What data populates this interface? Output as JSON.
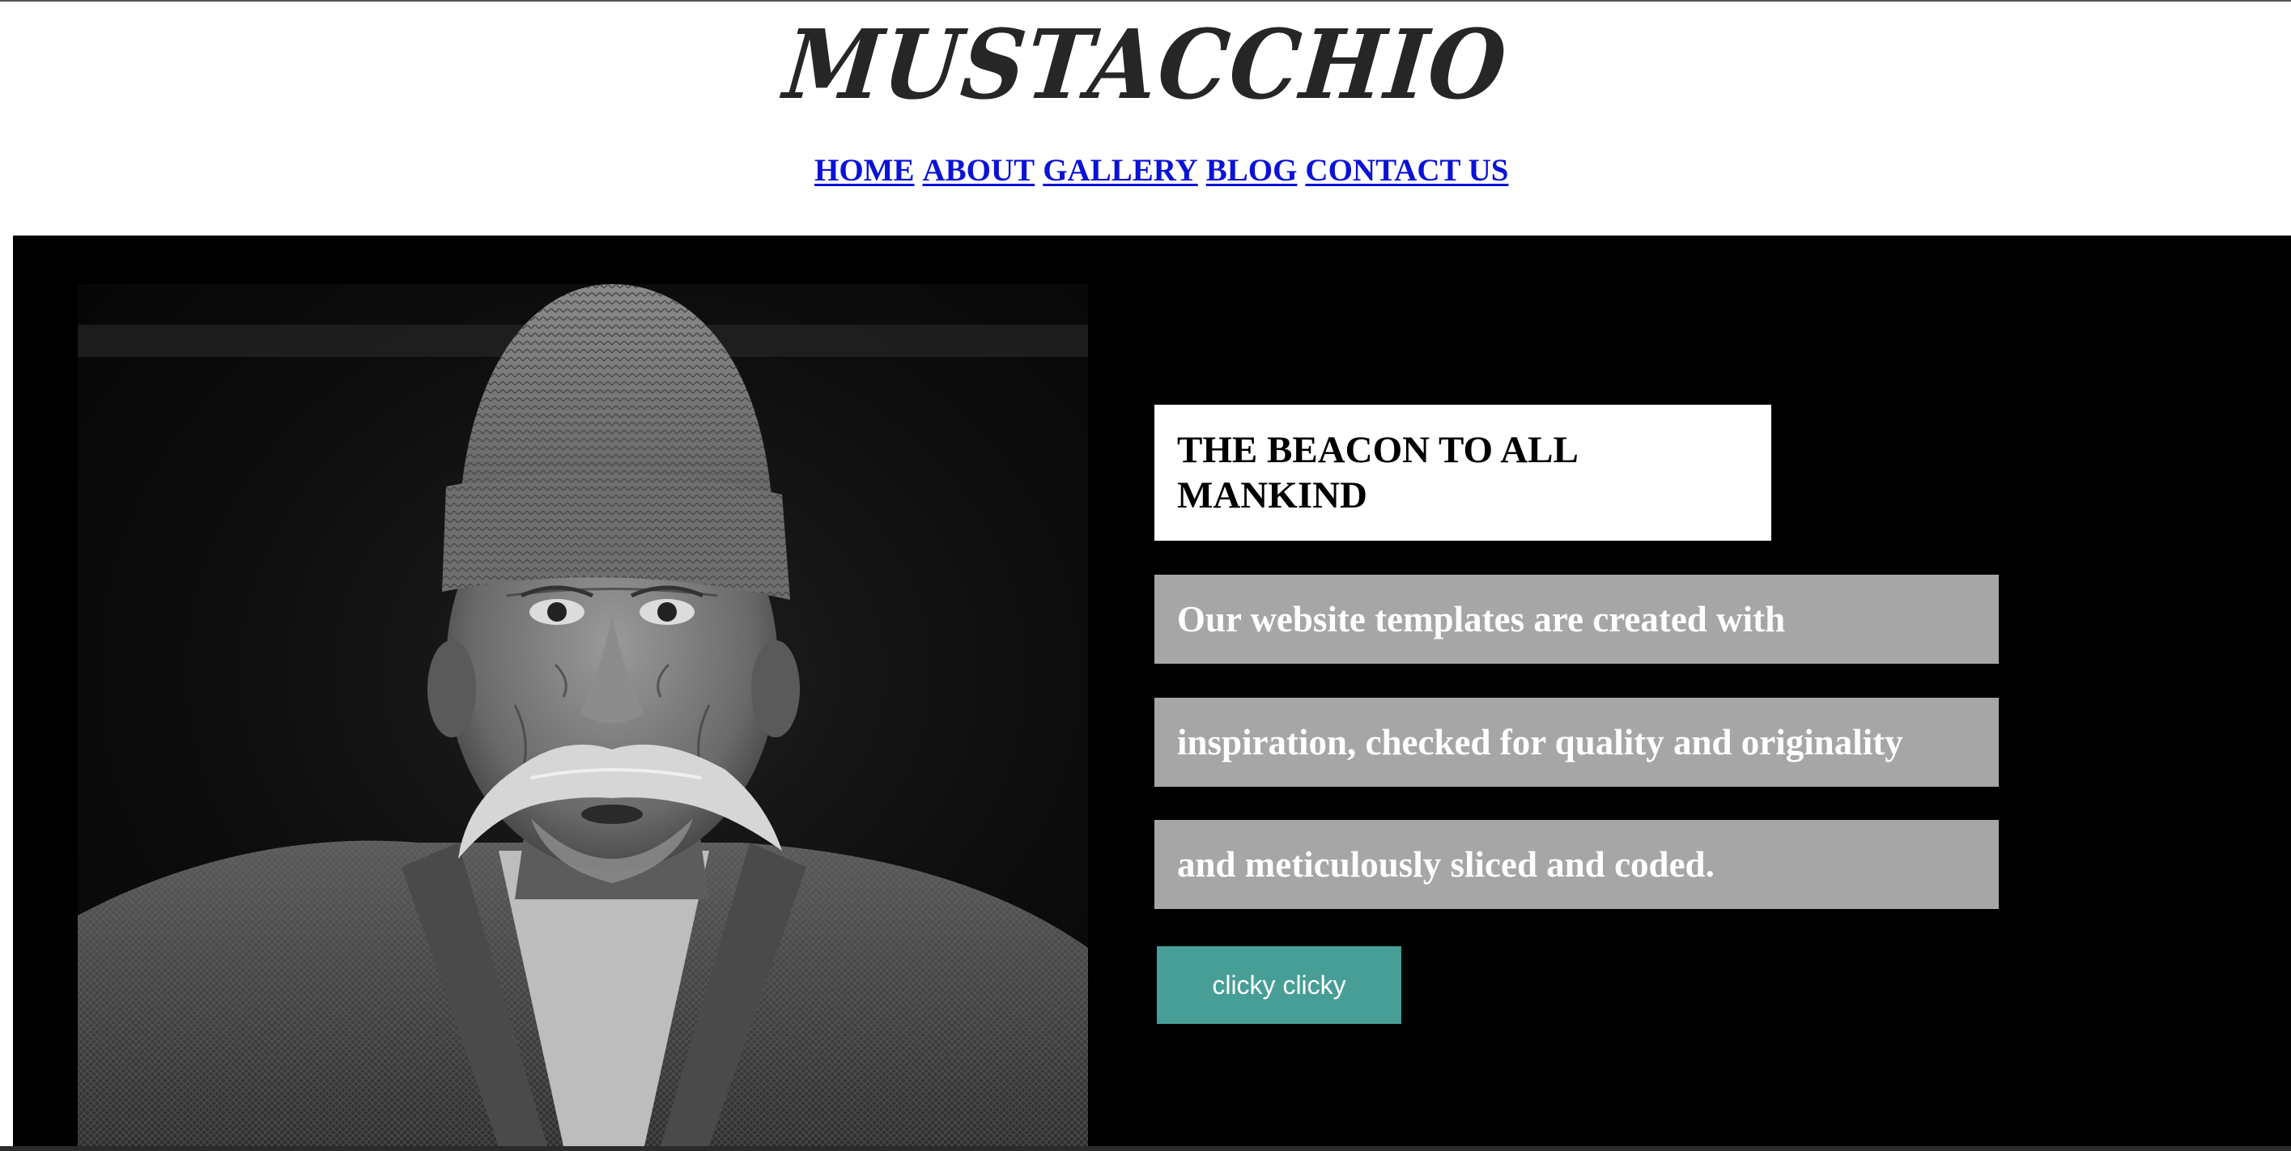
{
  "header": {
    "logo_text": "MUSTACCHIO"
  },
  "nav": {
    "items": [
      {
        "label": "HOME"
      },
      {
        "label": "ABOUT"
      },
      {
        "label": "GALLERY"
      },
      {
        "label": "BLOG"
      },
      {
        "label": "CONTACT US"
      }
    ]
  },
  "hero": {
    "photo_subject": "portrait-old-man-mustache-beanie",
    "title": "THE BEACON TO ALL MANKIND",
    "lines": [
      "Our website templates are created with",
      "inspiration, checked for quality and originality",
      "and meticulously sliced and coded."
    ],
    "button_label": "clicky clicky"
  },
  "colors": {
    "nav_link": "#0a12d6",
    "hero_background": "#000000",
    "text_bar": "#a6a6a6",
    "button": "#479e96",
    "title_box": "#ffffff"
  }
}
